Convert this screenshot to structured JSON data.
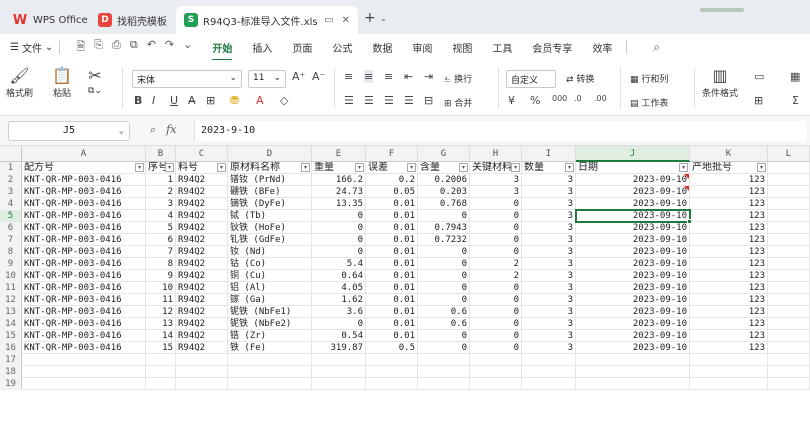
{
  "tabs": {
    "wps": "WPS Office",
    "daoke": "找稻壳模板",
    "file": "R94Q3-标准导入文件.xls"
  },
  "menu": {
    "file": "文件",
    "items": [
      "开始",
      "插入",
      "页面",
      "公式",
      "数据",
      "审阅",
      "视图",
      "工具",
      "会员专享",
      "效率"
    ]
  },
  "ribbon": {
    "format_painter": "格式刷",
    "paste": "粘贴",
    "font_name": "宋体",
    "font_size": "11",
    "wrap_text": "换行",
    "merge": "合并",
    "number_format": "自定义",
    "convert": "转换",
    "rows_cols": "行和列",
    "worksheet": "工作表",
    "conditional_format": "条件格式"
  },
  "formula_bar": {
    "cell_ref": "J5",
    "fx": "fx",
    "formula": "2023-9-10"
  },
  "grid": {
    "columns": [
      "A",
      "B",
      "C",
      "D",
      "E",
      "F",
      "G",
      "H",
      "I",
      "J",
      "K",
      "L"
    ],
    "headers": [
      "配方号",
      "序号",
      "料号",
      "原材料名称",
      "重量",
      "误差",
      "含量",
      "关键材料",
      "数量",
      "日期",
      "产地批号",
      ""
    ],
    "rows": [
      [
        "KNT-QR-MP-003-0416",
        "1",
        "R94Q2",
        "镨钕 (PrNd)",
        "166.2",
        "0.2",
        "0.2006",
        "3",
        "3",
        "2023-09-10",
        "123"
      ],
      [
        "KNT-QR-MP-003-0416",
        "2",
        "R94Q2",
        "硼铁 (BFe)",
        "24.73",
        "0.05",
        "0.203",
        "3",
        "3",
        "2023-09-10",
        "123"
      ],
      [
        "KNT-QR-MP-003-0416",
        "3",
        "R94Q2",
        "镝铁 (DyFe)",
        "13.35",
        "0.01",
        "0.768",
        "0",
        "3",
        "2023-09-10",
        "123"
      ],
      [
        "KNT-QR-MP-003-0416",
        "4",
        "R94Q2",
        "铽 (Tb)",
        "0",
        "0.01",
        "0",
        "0",
        "3",
        "2023-09-10",
        "123"
      ],
      [
        "KNT-QR-MP-003-0416",
        "5",
        "R94Q2",
        "钬铁 (HoFe)",
        "0",
        "0.01",
        "0.7943",
        "0",
        "3",
        "2023-09-10",
        "123"
      ],
      [
        "KNT-QR-MP-003-0416",
        "6",
        "R94Q2",
        "钆铁 (GdFe)",
        "0",
        "0.01",
        "0.7232",
        "0",
        "3",
        "2023-09-10",
        "123"
      ],
      [
        "KNT-QR-MP-003-0416",
        "7",
        "R94Q2",
        "钕 (Nd)",
        "0",
        "0.01",
        "0",
        "0",
        "3",
        "2023-09-10",
        "123"
      ],
      [
        "KNT-QR-MP-003-0416",
        "8",
        "R94Q2",
        "钴 (Co)",
        "5.4",
        "0.01",
        "0",
        "2",
        "3",
        "2023-09-10",
        "123"
      ],
      [
        "KNT-QR-MP-003-0416",
        "9",
        "R94Q2",
        "铜 (Cu)",
        "0.64",
        "0.01",
        "0",
        "2",
        "3",
        "2023-09-10",
        "123"
      ],
      [
        "KNT-QR-MP-003-0416",
        "10",
        "R94Q2",
        "铝 (Al)",
        "4.05",
        "0.01",
        "0",
        "0",
        "3",
        "2023-09-10",
        "123"
      ],
      [
        "KNT-QR-MP-003-0416",
        "11",
        "R94Q2",
        "镓 (Ga)",
        "1.62",
        "0.01",
        "0",
        "0",
        "3",
        "2023-09-10",
        "123"
      ],
      [
        "KNT-QR-MP-003-0416",
        "12",
        "R94Q2",
        "铌铁 (NbFe1)",
        "3.6",
        "0.01",
        "0.6",
        "0",
        "3",
        "2023-09-10",
        "123"
      ],
      [
        "KNT-QR-MP-003-0416",
        "13",
        "R94Q2",
        "铌铁 (NbFe2)",
        "0",
        "0.01",
        "0.6",
        "0",
        "3",
        "2023-09-10",
        "123"
      ],
      [
        "KNT-QR-MP-003-0416",
        "14",
        "R94Q2",
        "锆 (Zr)",
        "0.54",
        "0.01",
        "0",
        "0",
        "3",
        "2023-09-10",
        "123"
      ],
      [
        "KNT-QR-MP-003-0416",
        "15",
        "R94Q2",
        "铁 (Fe)",
        "319.87",
        "0.5",
        "0",
        "0",
        "3",
        "2023-09-10",
        "123"
      ]
    ],
    "row_numbers": [
      "1",
      "2",
      "3",
      "4",
      "5",
      "6",
      "7",
      "8",
      "9",
      "10",
      "11",
      "12",
      "13",
      "14",
      "15",
      "16",
      "17",
      "18",
      "19"
    ]
  }
}
